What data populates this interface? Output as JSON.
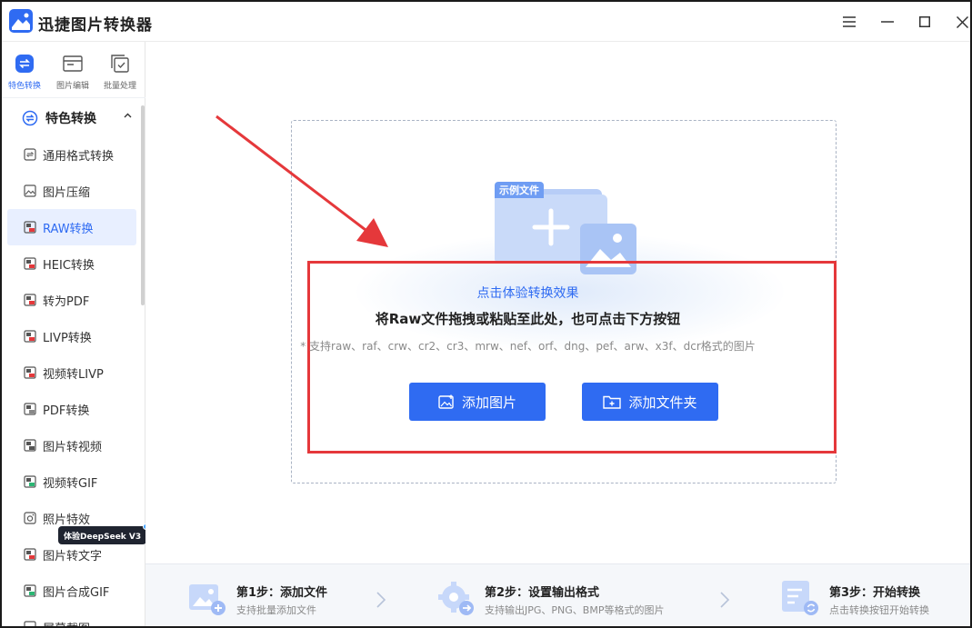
{
  "app": {
    "title": "迅捷图片转换器"
  },
  "topnav": [
    {
      "label": "特色转换",
      "active": true
    },
    {
      "label": "图片编辑",
      "active": false
    },
    {
      "label": "批量处理",
      "active": false
    }
  ],
  "sidebar": {
    "group_title": "特色转换",
    "items": [
      {
        "label": "通用格式转换",
        "icon": "convert-icon"
      },
      {
        "label": "图片压缩",
        "icon": "image-icon"
      },
      {
        "label": "RAW转换",
        "icon": "raw-icon",
        "active": true
      },
      {
        "label": "HEIC转换",
        "icon": "heic-icon"
      },
      {
        "label": "转为PDF",
        "icon": "pdf-icon"
      },
      {
        "label": "LIVP转换",
        "icon": "livp-icon"
      },
      {
        "label": "视频转LIVP",
        "icon": "video-icon"
      },
      {
        "label": "PDF转换",
        "icon": "pdf-convert-icon"
      },
      {
        "label": "图片转视频",
        "icon": "image-video-icon"
      },
      {
        "label": "视频转GIF",
        "icon": "gif-icon"
      },
      {
        "label": "照片特效",
        "icon": "effect-icon"
      },
      {
        "label": "图片转文字",
        "icon": "ocr-icon"
      },
      {
        "label": "图片合成GIF",
        "icon": "merge-gif-icon"
      },
      {
        "label": "屏幕截图",
        "icon": "screenshot-icon"
      }
    ],
    "deepseek_badge": "体验DeepSeek V3"
  },
  "dropzone": {
    "sample_tag": "示例文件",
    "try_link": "点击体验转换效果",
    "main_hint": "将Raw文件拖拽或粘贴至此处，也可点击下方按钮",
    "formats_hint": "* 支持raw、raf、crw、cr2、cr3、mrw、nef、orf、dng、pef、arw、x3f、dcr格式的图片",
    "add_image_label": "添加图片",
    "add_folder_label": "添加文件夹"
  },
  "steps": [
    {
      "title": "第1步：添加文件",
      "desc": "支持批量添加文件"
    },
    {
      "title": "第2步：设置输出格式",
      "desc": "支持输出JPG、PNG、BMP等格式的图片"
    },
    {
      "title": "第3步：开始转换",
      "desc": "点击转换按钮开始转换"
    }
  ],
  "colors": {
    "accent": "#2f6bf2",
    "highlight_red": "#e5383b",
    "active_bg": "#e8efff"
  }
}
